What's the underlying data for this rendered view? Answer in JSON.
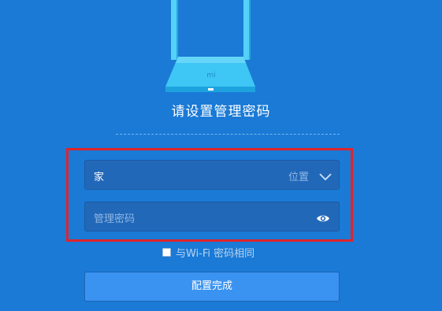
{
  "illustration": {
    "icon": "router-icon",
    "brand_mark": "mi"
  },
  "page_title": "请设置管理密码",
  "location_field": {
    "value": "家",
    "hint": "位置",
    "icon": "chevron-down-icon"
  },
  "password_field": {
    "placeholder": "管理密码",
    "icon": "eye-icon"
  },
  "same_as_wifi": {
    "label": "与Wi-Fi 密码相同",
    "checked": false
  },
  "submit_label": "配置完成",
  "colors": {
    "background": "#1a7ad6",
    "field_background": "#2268b9",
    "button_background": "#3a93f1",
    "highlight_border": "#e0242b",
    "router": "#3dc3f2"
  }
}
